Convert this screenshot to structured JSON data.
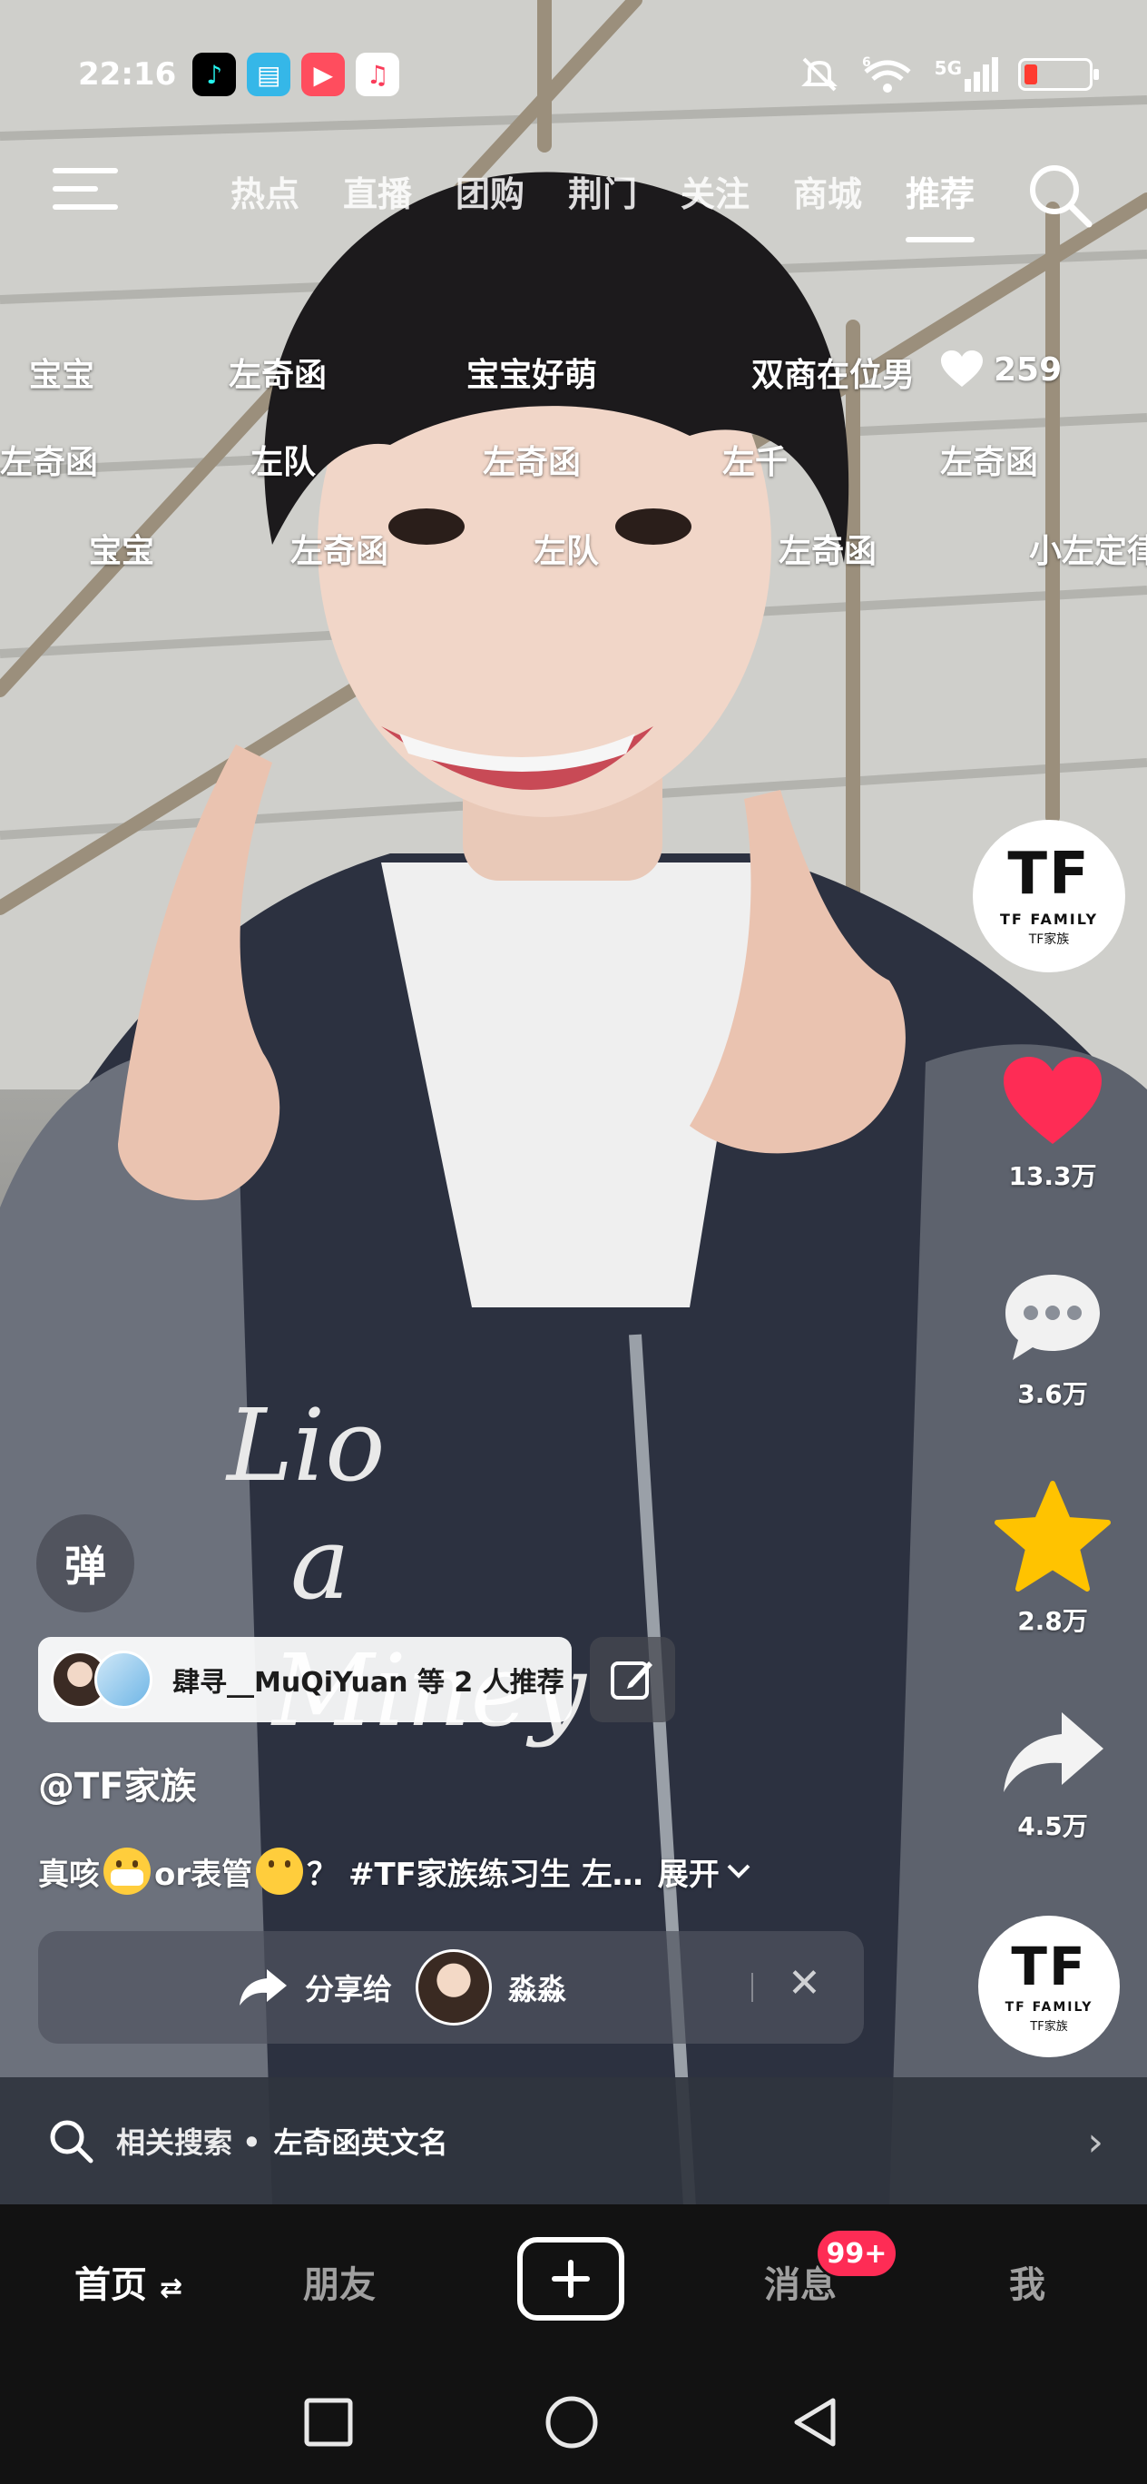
{
  "status_bar": {
    "time": "22:16",
    "network": "5G",
    "wifi_superscript": "6",
    "apps": [
      "tiktok-icon",
      "books-icon",
      "video-icon",
      "music-icon"
    ]
  },
  "top_nav": {
    "tabs": [
      "热点",
      "直播",
      "团购",
      "荆门",
      "关注",
      "商城",
      "推荐"
    ],
    "active_tab": "推荐"
  },
  "danmaku": {
    "row1": [
      "宝宝",
      "左奇函",
      "宝宝好萌",
      "双商在位男"
    ],
    "row1_likes": "259",
    "row2": [
      "左奇函",
      "左队",
      "左奇函",
      "左千",
      "左奇函"
    ],
    "row3": [
      "宝宝",
      "左奇函",
      "左队",
      "左奇函",
      "小左定律"
    ]
  },
  "actions": {
    "author_avatar_text": "TF",
    "author_avatar_sub1": "TF FAMILY",
    "author_avatar_sub2": "TF家族",
    "likes": "13.3万",
    "comments": "3.6万",
    "favorites": "2.8万",
    "shares": "4.5万",
    "music_avatar_text": "TF",
    "music_avatar_sub1": "TF FAMILY",
    "music_avatar_sub2": "TF家族"
  },
  "danmaku_toggle": "弹",
  "recommend": {
    "text": "肆寻__MuQiYuan 等 2 人推荐"
  },
  "post": {
    "author": "@TF家族",
    "desc_part1": "真咳",
    "desc_part2": "or表管",
    "desc_part3": "？ #TF家族练习生  左…",
    "expand": "展开"
  },
  "share_bar": {
    "label": "分享给",
    "friend": "淼淼"
  },
  "related_search": {
    "label": "相关搜索 •",
    "query": "左奇函英文名"
  },
  "bottom_tabs": {
    "home": "首页",
    "friends": "朋友",
    "messages": "消息",
    "messages_badge": "99+",
    "me": "我"
  },
  "colors": {
    "like": "#fe2c55",
    "favorite": "#ffc300",
    "badge": "#fe2c55"
  }
}
